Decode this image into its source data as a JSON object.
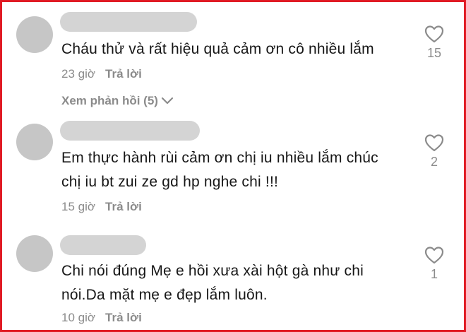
{
  "comments": [
    {
      "text_lines": [
        "Cháu thử và rất hiệu quả cảm ơn cô nhiều lắm"
      ],
      "time": "23 giờ",
      "reply_label": "Trả lời",
      "view_replies": "Xem phản hồi (5)",
      "likes": "15"
    },
    {
      "text_lines": [
        "Em thực hành rùi cảm ơn chị iu nhiều lắm chúc",
        "chị iu bt zui ze gd hp nghe chi !!!"
      ],
      "time": "15 giờ",
      "reply_label": "Trả lời",
      "likes": "2"
    },
    {
      "text_lines": [
        "Chi nói đúng Mẹ e hồi xưa xài hột gà như chi",
        "nói.Da mặt mẹ e đẹp lắm luôn."
      ],
      "time": "10 giờ",
      "reply_label": "Trả lời",
      "likes": "1"
    }
  ],
  "icons": {
    "like": "heart-outline-icon",
    "expand": "chevron-down-icon"
  },
  "colors": {
    "border": "#e01b24",
    "muted": "#8b8b8b",
    "avatar": "#c6c6c6"
  }
}
